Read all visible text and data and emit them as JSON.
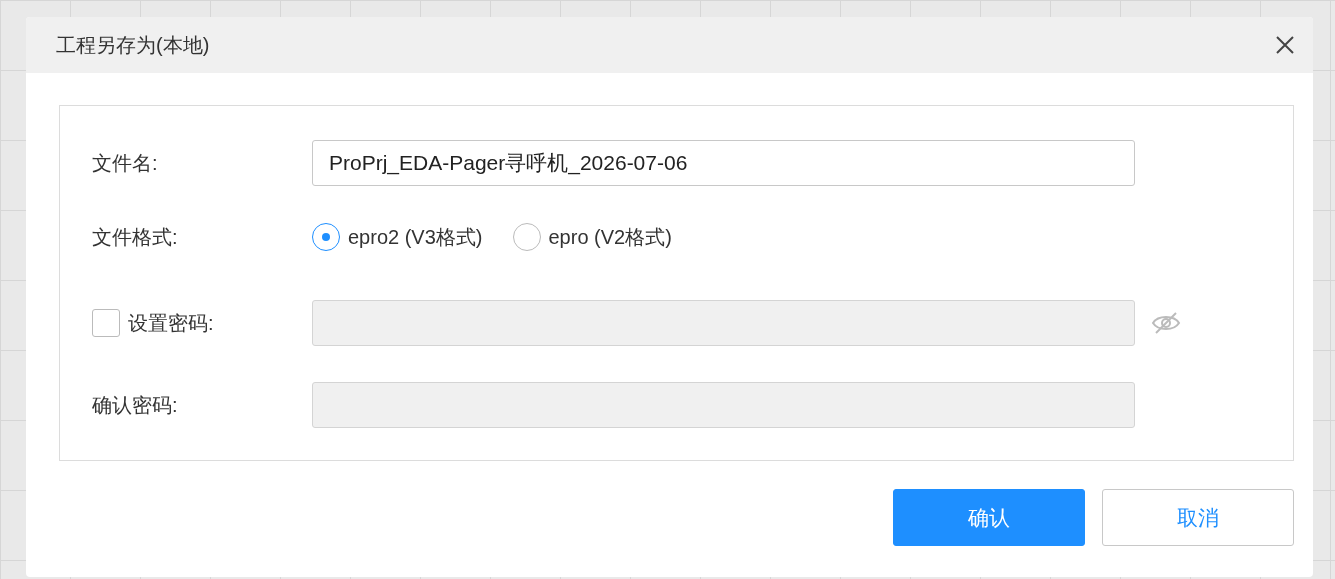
{
  "dialog": {
    "title": "工程另存为(本地)"
  },
  "file_name": {
    "label": "文件名:",
    "value": "ProPrj_EDA-Pager寻呼机_2026-07-06"
  },
  "file_format": {
    "label": "文件格式:",
    "options": [
      {
        "label": "epro2 (V3格式)",
        "selected": true
      },
      {
        "label": "epro (V2格式)",
        "selected": false
      }
    ]
  },
  "set_password": {
    "label": "设置密码:",
    "checked": false,
    "disabled": true
  },
  "confirm_password": {
    "label": "确认密码:",
    "disabled": true
  },
  "buttons": [
    {
      "label": "确认",
      "kind": "primary"
    },
    {
      "label": "取消",
      "kind": "secondary"
    }
  ]
}
